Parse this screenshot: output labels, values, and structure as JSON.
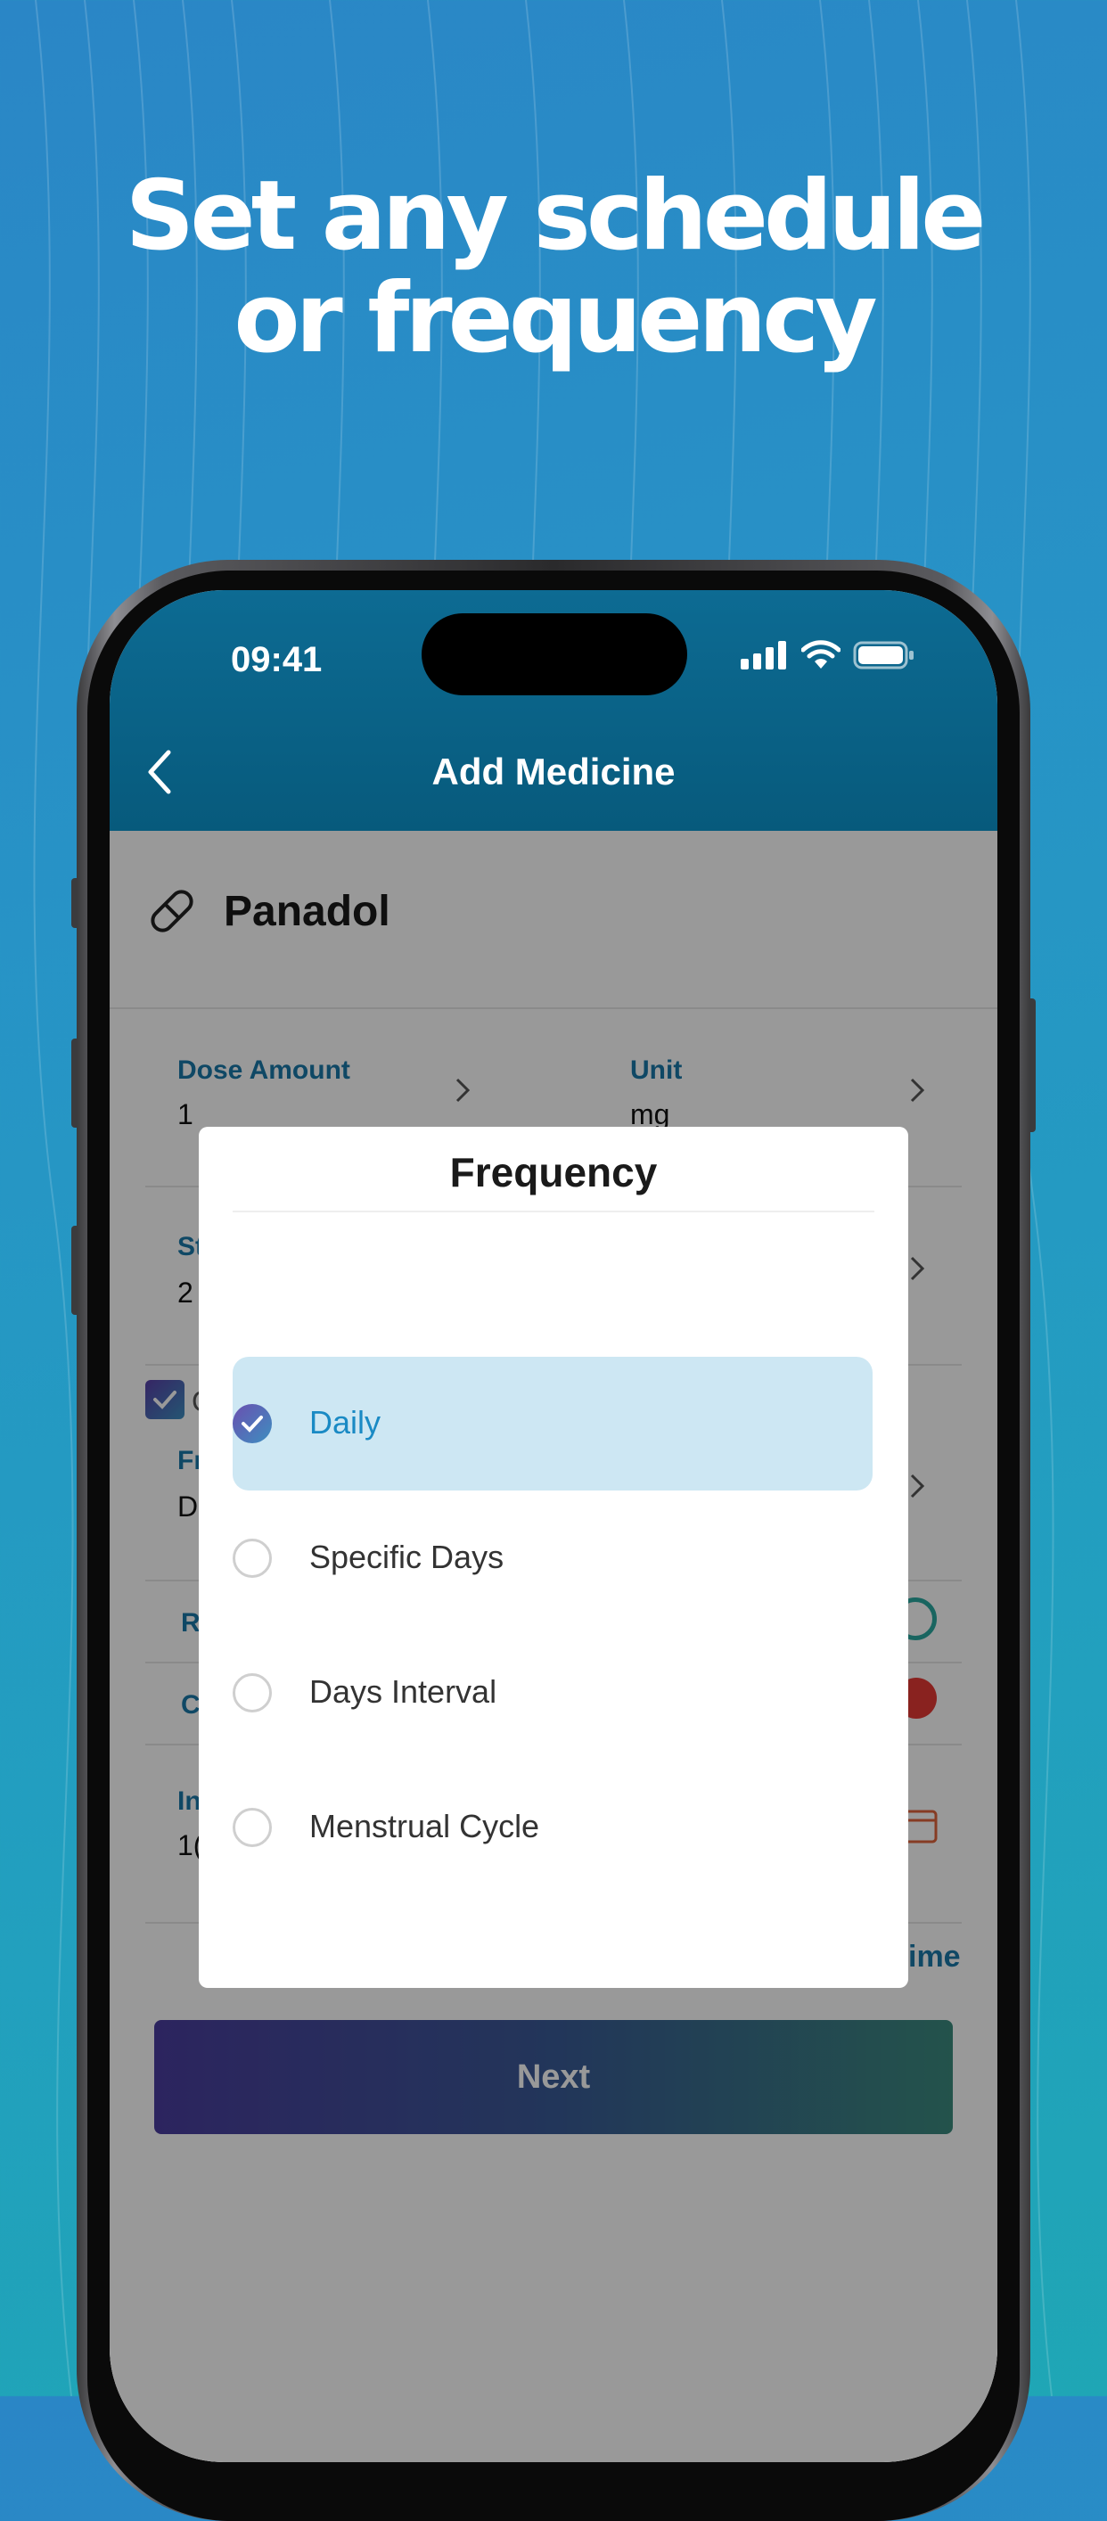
{
  "headline": {
    "line1": "Set any schedule",
    "line2": "or frequency"
  },
  "status_bar": {
    "time": "09:41"
  },
  "header": {
    "title": "Add Medicine"
  },
  "medicine": {
    "name": "Panadol"
  },
  "form": {
    "dose_amount_label": "Dose Amount",
    "dose_amount_value": "1",
    "unit_label": "Unit",
    "unit_value": "mg",
    "start_label": "St",
    "start_value": "2",
    "checkbox_label": "C",
    "frequency_label": "Fr",
    "frequency_value": "D",
    "reminder_label": "R",
    "color_label": "C",
    "instruction_label": "In",
    "instruction_value": "1(",
    "add_time_link": "ime",
    "next_button": "Next"
  },
  "modal": {
    "title": "Frequency",
    "options": [
      {
        "label": "Daily",
        "selected": true
      },
      {
        "label": "Specific Days",
        "selected": false
      },
      {
        "label": "Days Interval",
        "selected": false
      },
      {
        "label": "Menstrual Cycle",
        "selected": false
      }
    ]
  },
  "colors": {
    "header": "#075a7c",
    "accent": "#1a78a8",
    "selected_option_bg": "#cde7f3"
  }
}
